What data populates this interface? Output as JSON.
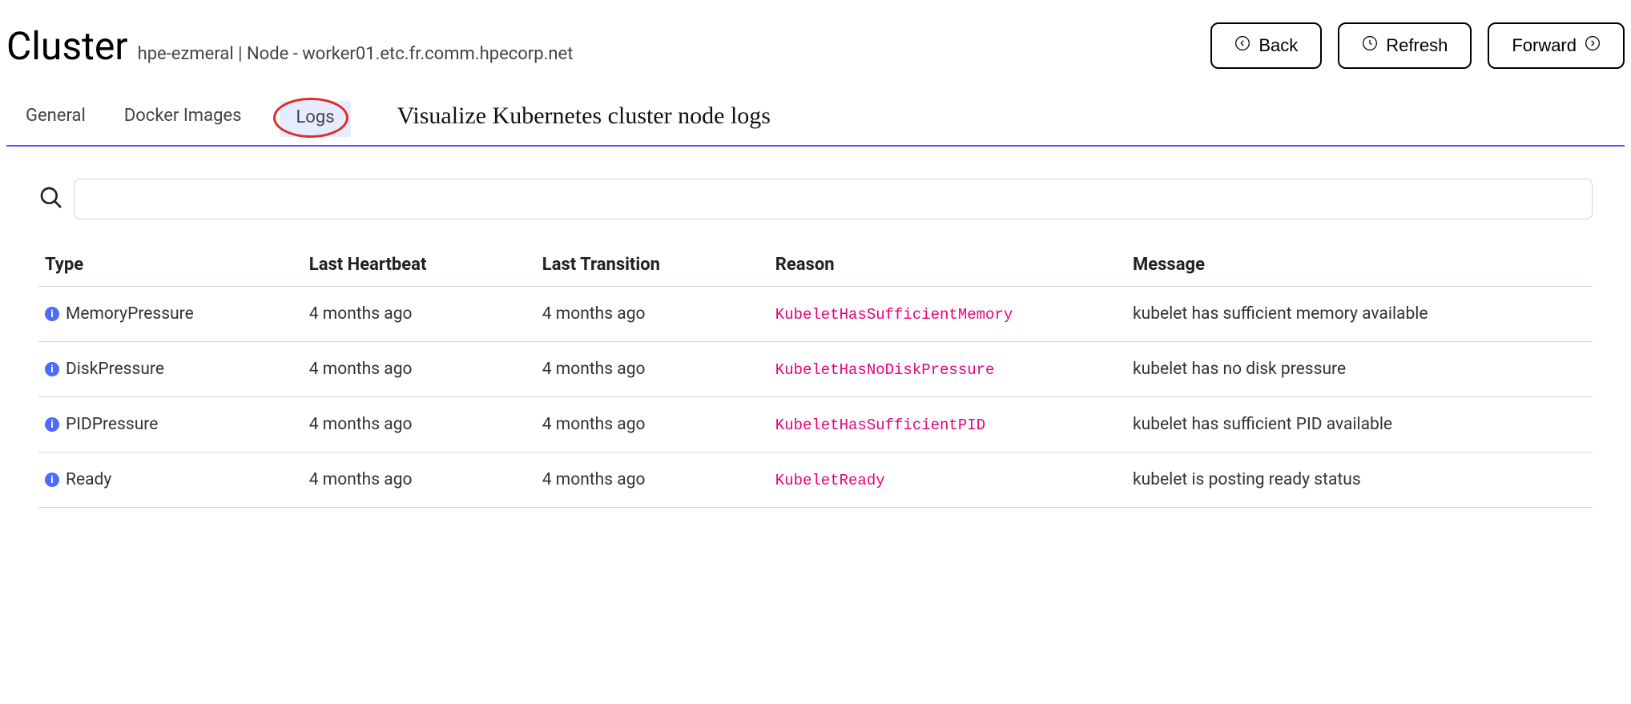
{
  "header": {
    "title": "Cluster",
    "breadcrumb": "hpe-ezmeral | Node - worker01.etc.fr.comm.hpecorp.net",
    "buttons": {
      "back": "Back",
      "refresh": "Refresh",
      "forward": "Forward"
    }
  },
  "tabs": {
    "general": "General",
    "docker_images": "Docker Images",
    "logs": "Logs"
  },
  "annotation": "Visualize Kubernetes cluster node logs",
  "search": {
    "value": "",
    "placeholder": ""
  },
  "table": {
    "headers": {
      "type": "Type",
      "last_heartbeat": "Last Heartbeat",
      "last_transition": "Last Transition",
      "reason": "Reason",
      "message": "Message"
    },
    "rows": [
      {
        "type": "MemoryPressure",
        "last_heartbeat": "4 months ago",
        "last_transition": "4 months ago",
        "reason": "KubeletHasSufficientMemory",
        "message": "kubelet has sufficient memory available"
      },
      {
        "type": "DiskPressure",
        "last_heartbeat": "4 months ago",
        "last_transition": "4 months ago",
        "reason": "KubeletHasNoDiskPressure",
        "message": "kubelet has no disk pressure"
      },
      {
        "type": "PIDPressure",
        "last_heartbeat": "4 months ago",
        "last_transition": "4 months ago",
        "reason": "KubeletHasSufficientPID",
        "message": "kubelet has sufficient PID available"
      },
      {
        "type": "Ready",
        "last_heartbeat": "4 months ago",
        "last_transition": "4 months ago",
        "reason": "KubeletReady",
        "message": "kubelet is posting ready status"
      }
    ]
  }
}
